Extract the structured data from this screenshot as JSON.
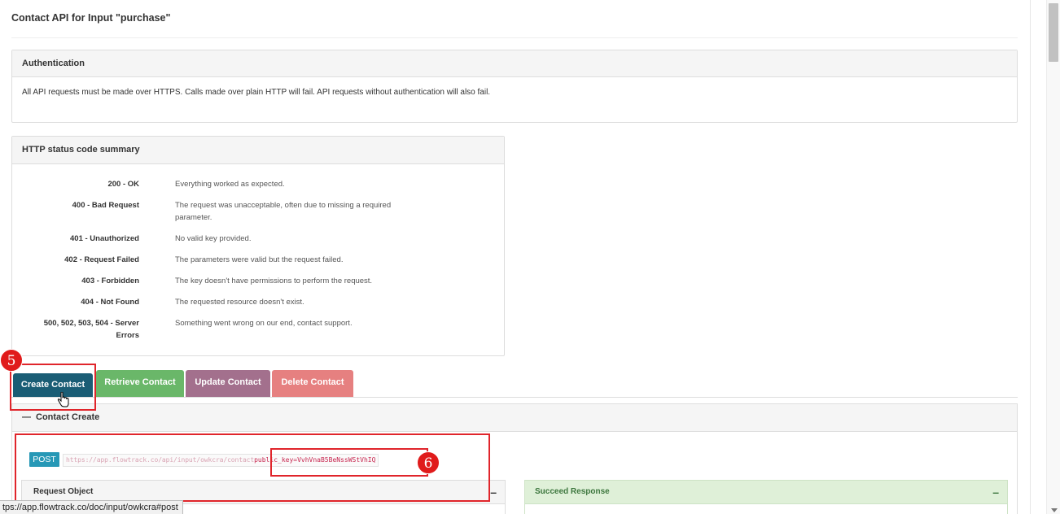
{
  "page": {
    "title": "Contact API for Input \"purchase\""
  },
  "auth": {
    "heading": "Authentication",
    "text": "All API requests must be made over HTTPS. Calls made over plain HTTP will fail. API requests without authentication will also fail."
  },
  "status": {
    "heading": "HTTP status code summary",
    "rows": [
      {
        "code": "200 - OK",
        "desc": "Everything worked as expected."
      },
      {
        "code": "400 - Bad Request",
        "desc": "The request was unacceptable, often due to missing a required parameter."
      },
      {
        "code": "401 - Unauthorized",
        "desc": "No valid key provided."
      },
      {
        "code": "402 - Request Failed",
        "desc": "The parameters were valid but the request failed."
      },
      {
        "code": "403 - Forbidden",
        "desc": "The key doesn't have permissions to perform the request."
      },
      {
        "code": "404 - Not Found",
        "desc": "The requested resource doesn't exist."
      },
      {
        "code": "500, 502, 503, 504 - Server Errors",
        "desc": "Something went wrong on our end, contact support."
      }
    ]
  },
  "tabs": {
    "create": "Create Contact",
    "retrieve": "Retrieve Contact",
    "update": "Update Contact",
    "delete": "Delete Contact"
  },
  "create": {
    "heading": "Contact Create",
    "method": "POST",
    "url_base": "https://app.flowtrack.co/api/input/owkcra/contact",
    "url_param": "public_key=VvhVnaB5BeNssWStVhIQ",
    "request_heading": "Request Object",
    "success_heading": "Succeed Response"
  },
  "annotations": {
    "marker_5": "5",
    "marker_6": "6"
  },
  "statusbar": {
    "url": "tps://app.flowtrack.co/doc/input/owkcra#post"
  },
  "colors": {
    "create_tab": "#1a5d75",
    "retrieve_tab": "#6ab769",
    "update_tab": "#a3708d",
    "delete_tab": "#e68080",
    "post_badge": "#2798b6",
    "highlight": "#e0252b"
  }
}
